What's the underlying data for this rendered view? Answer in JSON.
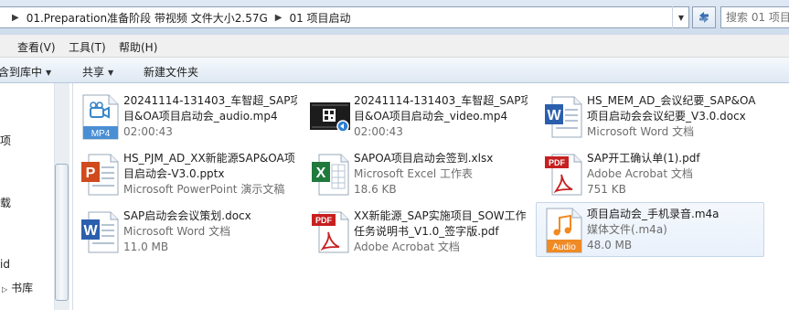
{
  "address": {
    "segments": [
      "01.Preparation准备阶段 带视频 文件大小2.57G",
      "01 项目启动"
    ],
    "search_placeholder": "搜索 01 项目"
  },
  "menu": [
    "查看(V)",
    "工具(T)",
    "帮助(H)"
  ],
  "toolbar": {
    "include_library": "含到库中",
    "share": "共享",
    "new_folder": "新建文件夹"
  },
  "nav": {
    "items": [
      "项",
      "载",
      "id",
      "书库"
    ]
  },
  "files": [
    {
      "name_lines": [
        "20241114-131403_车智超_SAP项",
        "目&OA项目启动会_audio.mp4"
      ],
      "meta": "02:00:43",
      "icon": "mp4-video-file-icon",
      "badge": "MP4"
    },
    {
      "name_lines": [
        "20241114-131403_车智超_SAP项",
        "目&OA项目启动会_video.mp4"
      ],
      "meta": "02:00:43",
      "icon": "video-thumbnail-icon"
    },
    {
      "name_lines": [
        "HS_MEM_AD_会议纪要_SAP&OA",
        "项目启动会会议纪要_V3.0.docx"
      ],
      "meta": "Microsoft Word 文档",
      "icon": "word-document-icon"
    },
    {
      "name_lines": [
        "HS_PJM_AD_XX新能源SAP&OA项",
        "目启动会-V3.0.pptx"
      ],
      "meta": "Microsoft PowerPoint 演示文稿",
      "icon": "powerpoint-document-icon"
    },
    {
      "name_lines": [
        "SAPOA项目启动会签到.xlsx"
      ],
      "meta_lines": [
        "Microsoft Excel 工作表",
        "18.6 KB"
      ],
      "icon": "excel-document-icon"
    },
    {
      "name_lines": [
        "SAP开工确认单(1).pdf"
      ],
      "meta_lines": [
        "Adobe Acrobat 文档",
        "751 KB"
      ],
      "icon": "pdf-document-icon",
      "badge": "PDF"
    },
    {
      "name_lines": [
        "SAP启动会会议策划.docx"
      ],
      "meta_lines": [
        "Microsoft Word 文档",
        "11.0 MB"
      ],
      "icon": "word-document-icon"
    },
    {
      "name_lines": [
        "XX新能源_SAP实施项目_SOW工作",
        "任务说明书_V1.0_签字版.pdf"
      ],
      "meta": "Adobe Acrobat 文档",
      "icon": "pdf-document-icon",
      "badge": "PDF"
    },
    {
      "name_lines": [
        "项目启动会_手机录音.m4a"
      ],
      "meta_lines": [
        "媒体文件(.m4a)",
        "48.0 MB"
      ],
      "icon": "audio-file-icon",
      "badge": "Audio",
      "selected": true
    }
  ]
}
